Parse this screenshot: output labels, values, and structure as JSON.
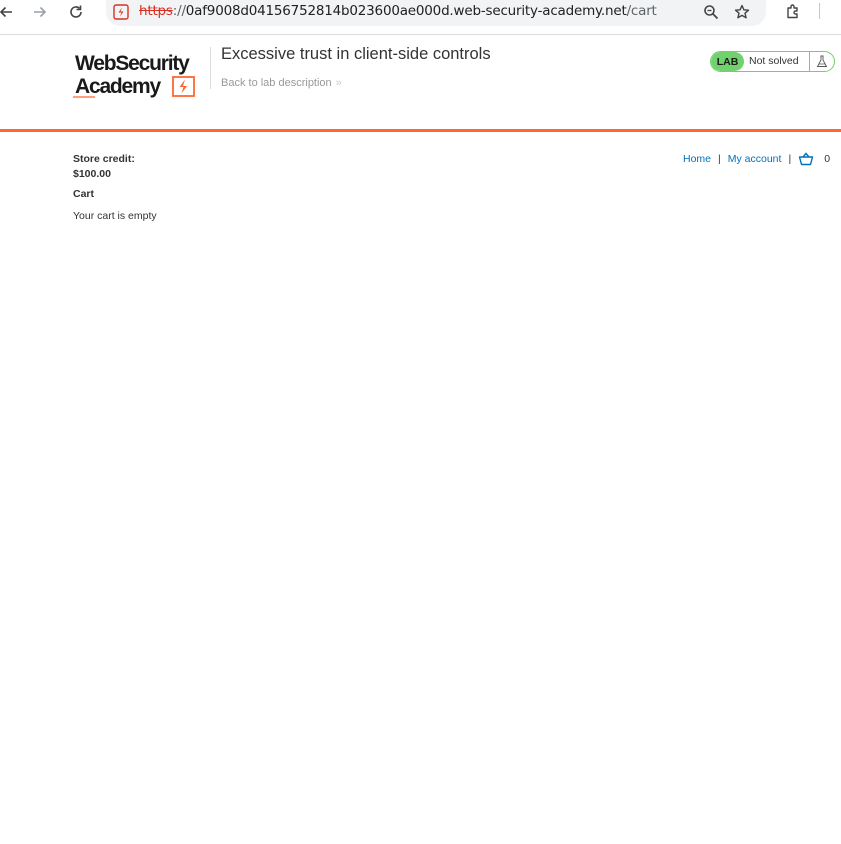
{
  "browser": {
    "url_scheme": "https",
    "url_sep": "://",
    "url_host": "0af9008d04156752814b023600ae000d.web-security-academy.net",
    "url_path": "/cart",
    "icons": [
      "back-arrow-icon",
      "forward-arrow-icon",
      "reload-icon",
      "site-info-icon",
      "zoom-icon",
      "bookmark-star-icon",
      "extensions-icon",
      "profile-icon"
    ]
  },
  "lab_header": {
    "logo_line1": "WebSecurity",
    "logo_line2": "Academy",
    "title": "Excessive trust in client-side controls",
    "back_link": "Back to lab description",
    "back_chevron": "»",
    "badge": "LAB",
    "status": "Not solved",
    "accent_color": "#ff6633",
    "status_color": "#70d16d"
  },
  "page": {
    "store_credit_label": "Store credit:",
    "store_credit_value": "$100.00",
    "cart_heading": "Cart",
    "cart_empty": "Your cart is empty"
  },
  "nav": {
    "home": "Home",
    "separator": "|",
    "my_account": "My account",
    "cart_count": "0",
    "link_color": "#0071bc"
  }
}
